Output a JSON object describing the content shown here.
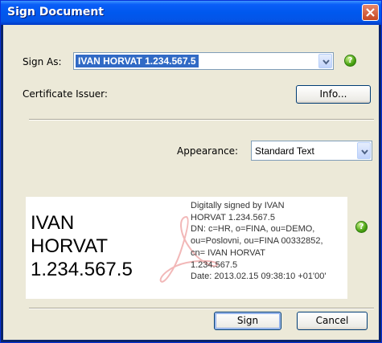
{
  "window": {
    "title": "Sign Document"
  },
  "sign_as": {
    "label": "Sign As:",
    "selected": "IVAN HORVAT 1.234.567.5"
  },
  "certificate_issuer": {
    "label": "Certificate Issuer:",
    "info_button": "Info..."
  },
  "appearance": {
    "label": "Appearance:",
    "selected": "Standard Text"
  },
  "preview": {
    "name_lines": [
      "IVAN",
      "HORVAT",
      "1.234.567.5"
    ],
    "detail_lines": [
      "Digitally signed by IVAN",
      "HORVAT 1.234.567.5",
      "DN: c=HR, o=FINA, ou=DEMO,",
      "ou=Poslovni, ou=FINA 00332852,",
      "cn= IVAN HORVAT",
      "1.234.567.5",
      "Date: 2013.02.15 09:38:10 +01'00'"
    ]
  },
  "buttons": {
    "sign": "Sign",
    "cancel": "Cancel"
  },
  "colors": {
    "titlebar": "#0058ee",
    "selection": "#316ac5",
    "dialog_bg": "#ece9d8",
    "help": "#4aa312"
  },
  "icons": {
    "help": "help-icon",
    "close": "close-icon",
    "dropdown": "chevron-down-icon"
  }
}
